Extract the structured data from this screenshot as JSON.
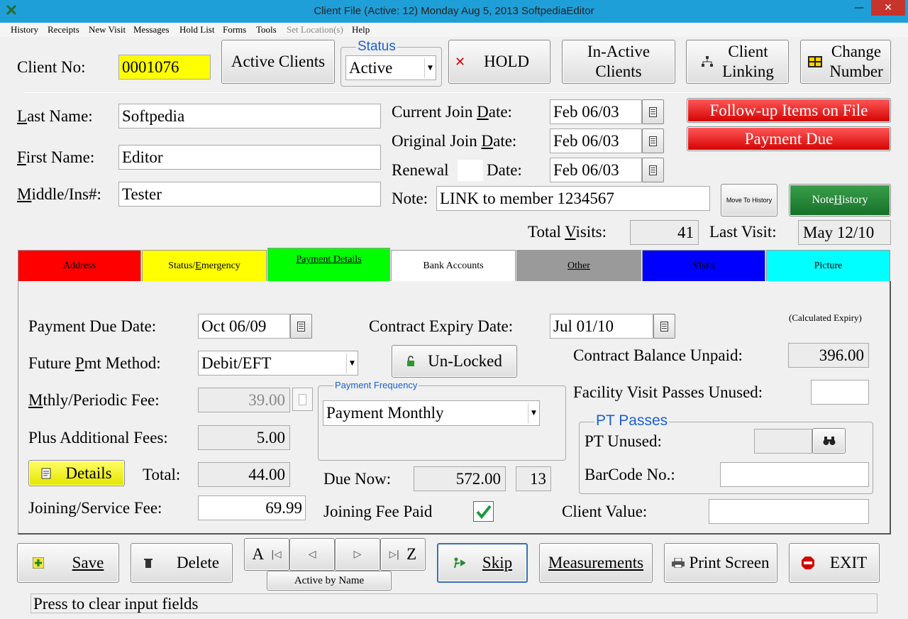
{
  "window": {
    "title": "Client File (Active: 12)     Monday   Aug 5, 2013 SoftpediaEditor",
    "minimize": "—",
    "close": "✕"
  },
  "menu": [
    "History",
    "Receipts",
    "New Visit",
    "Messages",
    "Hold List",
    "Forms",
    "Tools",
    "Set Location(s)",
    "Help"
  ],
  "header": {
    "client_no_label": "Client No:",
    "client_no": "0001076",
    "active_clients": "Active Clients",
    "status_label": "Status",
    "status_value": "Active",
    "hold": "HOLD",
    "inactive_clients": [
      "In-Active",
      "Clients"
    ],
    "client_linking": [
      "Client",
      "Linking"
    ],
    "change_number": [
      "Change",
      "Number"
    ]
  },
  "names": {
    "last_label": "Last Name:",
    "last": "Softpedia",
    "first_label": "First Name:",
    "first": "Editor",
    "middle_label": "Middle/Ins#:",
    "middle": "Tester"
  },
  "dates": {
    "current_join_label": "Current Join Date:",
    "current_join": "Feb 06/03",
    "original_join_label": "Original Join Date:",
    "original_join": "Feb 06/03",
    "renewal_label": "Renewal",
    "renewal_date_label": "Date:",
    "renewal": "Feb 06/03"
  },
  "alerts": {
    "followup": "Follow-up Items on File",
    "payment_due": "Payment Due"
  },
  "note": {
    "label": "Note:",
    "value": "LINK to member 1234567",
    "move_to_history": "Move To History",
    "note_history": "Note History"
  },
  "visits": {
    "total_label": "Total Visits:",
    "total": "41",
    "last_label": "Last Visit:",
    "last": "May 12/10"
  },
  "tabs": [
    {
      "label": "Address",
      "color": "#ff0000"
    },
    {
      "label": "Status/Emergency",
      "color": "#ffff00"
    },
    {
      "label": "Payment Details",
      "color": "#00ff00"
    },
    {
      "label": "Bank Accounts",
      "color": "#ffffff"
    },
    {
      "label": "Other",
      "color": "#9a9a9a"
    },
    {
      "label": "Visits",
      "color": "#0000ff"
    },
    {
      "label": "Picture",
      "color": "#00ffff"
    }
  ],
  "payment": {
    "due_date_label": "Payment Due Date:",
    "due_date": "Oct 06/09",
    "contract_expiry_label": "Contract Expiry Date:",
    "contract_expiry": "Jul 01/10",
    "calculated_expiry": "(Calculated Expiry)",
    "future_method_label": "Future Pmt Method:",
    "future_method": "Debit/EFT",
    "unlocked": "Un-Locked",
    "contract_balance_label": "Contract Balance Unpaid:",
    "contract_balance": "396.00",
    "periodic_fee_label": "Mthly/Periodic Fee:",
    "periodic_fee": "39.00",
    "frequency_label": "Payment Frequency",
    "frequency": "Payment Monthly",
    "facility_passes_label": "Facility Visit Passes Unused:",
    "facility_passes": "",
    "additional_fees_label": "Plus Additional Fees:",
    "additional_fees": "5.00",
    "pt_passes_label": "PT Passes",
    "pt_unused_label": "PT Unused:",
    "pt_unused": "",
    "barcode_label": "BarCode No.:",
    "barcode": "",
    "details": "Details",
    "total_label": "Total:",
    "total": "44.00",
    "due_now_label": "Due Now:",
    "due_now": "572.00",
    "due_now_count": "13",
    "joining_fee_label": "Joining/Service Fee:",
    "joining_fee": "69.99",
    "joining_paid_label": "Joining Fee Paid",
    "joining_paid": true,
    "client_value_label": "Client Value:",
    "client_value": ""
  },
  "bottom": {
    "save": "Save",
    "delete": "Delete",
    "nav_a": "A",
    "nav_z": "Z",
    "nav_sort": "Active by Name",
    "skip": "Skip",
    "measurements": "Measurements",
    "print_screen": "Print Screen",
    "exit": "EXIT"
  },
  "status_bar": "Press to clear input fields"
}
